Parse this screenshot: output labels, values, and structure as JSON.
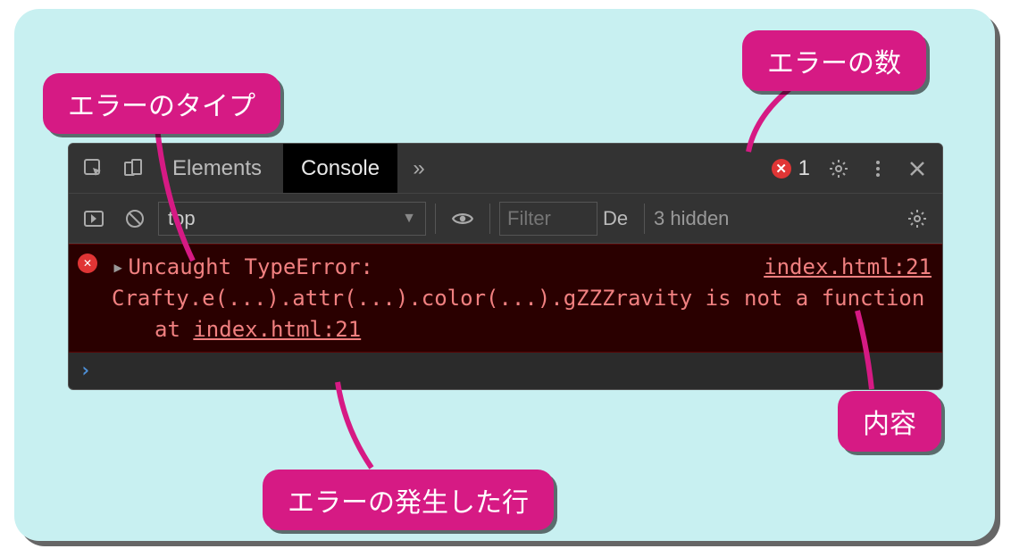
{
  "callouts": {
    "error_type": "エラーのタイプ",
    "error_count": "エラーの数",
    "error_line": "エラーの発生した行",
    "content": "内容"
  },
  "tabs": {
    "elements": "Elements",
    "console": "Console",
    "more_glyph": "»"
  },
  "header": {
    "error_badge_glyph": "✕",
    "error_count": "1"
  },
  "filter": {
    "context": "top",
    "context_arrow": "▼",
    "filter_placeholder": "Filter",
    "levels_truncated": "De",
    "hidden": "3 hidden"
  },
  "error": {
    "badge_glyph": "✕",
    "expand_glyph": "▸",
    "title": "Uncaught TypeError:",
    "source": "index.html:21",
    "message": "Crafty.e(...).attr(...).color(...).gZZZravity is not a function",
    "stack_at": "at ",
    "stack_source": "index.html:21"
  },
  "prompt": {
    "glyph": "›"
  }
}
